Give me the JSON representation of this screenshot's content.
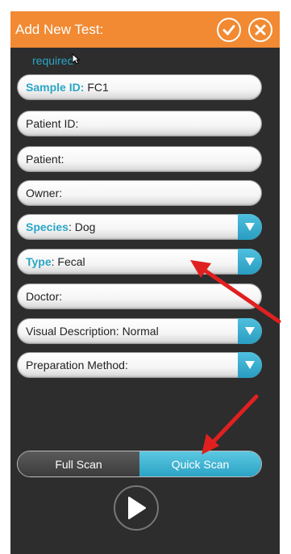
{
  "header": {
    "title": "Add New Test:",
    "confirm_icon": "checkmark-icon",
    "close_icon": "close-icon"
  },
  "required_note": "required",
  "fields": [
    {
      "label": "Sample ID:",
      "value": "FC1",
      "required": true,
      "dropdown": false
    },
    {
      "label": "Patient ID:",
      "value": "",
      "required": false,
      "dropdown": false
    },
    {
      "label": "Patient:",
      "value": "",
      "required": false,
      "dropdown": false
    },
    {
      "label": "Owner:",
      "value": "",
      "required": false,
      "dropdown": false
    },
    {
      "label": "Species",
      "value": ": Dog",
      "required": true,
      "dropdown": true
    },
    {
      "label": "Type",
      "value": ": Fecal",
      "required": true,
      "dropdown": true
    },
    {
      "label": "Doctor:",
      "value": "",
      "required": false,
      "dropdown": false
    },
    {
      "label": "Visual Description: Normal",
      "value": "",
      "required": false,
      "dropdown": true
    },
    {
      "label": "Preparation Method:",
      "value": "",
      "required": false,
      "dropdown": true
    }
  ],
  "scan": {
    "full_label": "Full Scan",
    "quick_label": "Quick Scan",
    "selected": "Quick Scan"
  },
  "colors": {
    "header": "#f18a33",
    "accent": "#2aa6c7",
    "panel": "#2d2d2d",
    "annotation_arrow": "#e02020"
  }
}
